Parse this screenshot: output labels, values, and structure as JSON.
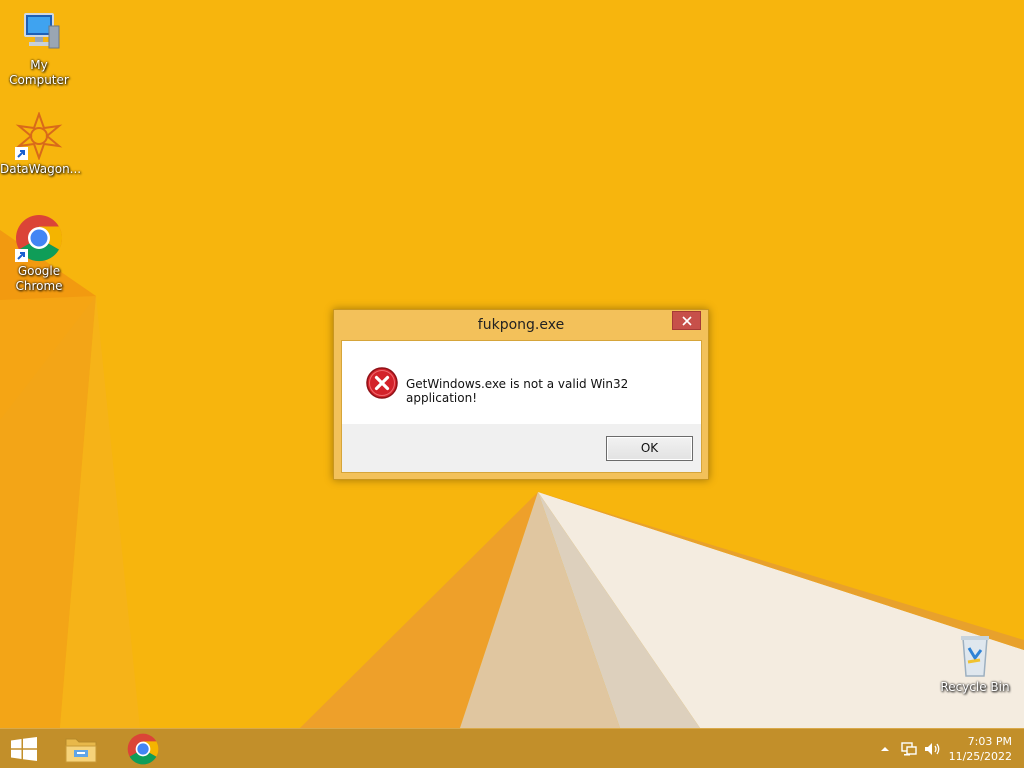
{
  "desktop": {
    "icons": [
      {
        "label": "My Computer",
        "icon": "computer-icon"
      },
      {
        "label": "DataWagon...",
        "icon": "datawagon-icon"
      },
      {
        "label": "Google Chrome",
        "icon": "chrome-icon"
      },
      {
        "label": "Recycle Bin",
        "icon": "recycle-bin-icon"
      }
    ]
  },
  "dialog": {
    "title": "fukpong.exe",
    "message": "GetWindows.exe is not a valid Win32 application!",
    "ok_label": "OK",
    "icon": "error-icon"
  },
  "taskbar": {
    "pinned": [
      {
        "name": "start-button",
        "icon": "windows-logo-icon"
      },
      {
        "name": "file-explorer",
        "icon": "folder-icon"
      },
      {
        "name": "google-chrome",
        "icon": "chrome-icon"
      }
    ],
    "tray": {
      "icons": [
        "chevron-up-icon",
        "network-icon",
        "volume-icon"
      ],
      "time": "7:03 PM",
      "date": "11/25/2022"
    }
  },
  "colors": {
    "wallpaper": "#f7b40a",
    "taskbar": "#c28f2a",
    "dialog_frame": "#f3c15a",
    "close_button": "#c7504a",
    "error_red": "#d3222a"
  }
}
